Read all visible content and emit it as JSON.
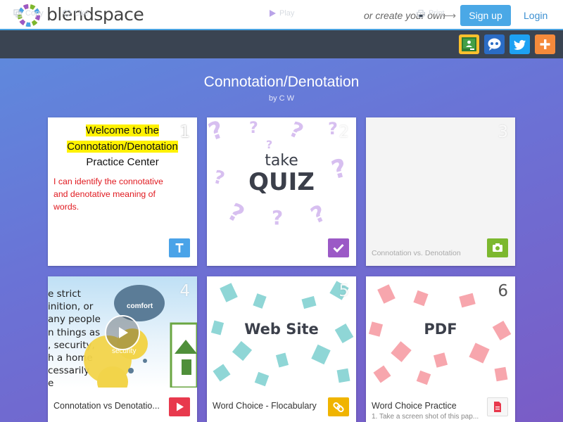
{
  "header": {
    "brand": "blendspace",
    "create_text": "or create your own",
    "signup": "Sign up",
    "login": "Login"
  },
  "toolbar": {
    "copy": "Copy",
    "like": "Like",
    "play": "Play",
    "print": "Print",
    "share": [
      "google-classroom-icon",
      "remind-icon",
      "twitter-icon",
      "plus-icon"
    ]
  },
  "lesson": {
    "title": "Connotation/Denotation",
    "author": "by C W"
  },
  "cards": [
    {
      "number": "1",
      "type": "text",
      "heading": [
        "Welcome to the",
        "Connotation/Denotation",
        "Practice Center"
      ],
      "body": [
        "I can identify the connotative",
        "and denotative meaning of",
        "words."
      ]
    },
    {
      "number": "2",
      "type": "quiz",
      "thumb_line1": "take",
      "thumb_line2": "QUIZ"
    },
    {
      "number": "3",
      "type": "image",
      "caption": "Connotation vs. Denotation"
    },
    {
      "number": "4",
      "type": "video",
      "caption": "Connotation vs  Denotatio...",
      "thumb_text": [
        "e strict",
        "inition, or",
        "any people",
        "n things as",
        ", security,",
        "h a home",
        "cessarily",
        "e"
      ],
      "cloud1": "comfort",
      "cloud2": "security"
    },
    {
      "number": "5",
      "type": "link",
      "thumb_label": "Web Site",
      "caption": "Word Choice - Flocabulary"
    },
    {
      "number": "6",
      "type": "pdf",
      "thumb_label": "PDF",
      "caption": "Word Choice Practice",
      "subcaption": "1. Take a screen shot of this pap..."
    }
  ],
  "colors": {
    "text_badge": "#4aa3e8",
    "quiz_badge": "#9b59c6",
    "image_badge": "#7cb82f",
    "video_badge": "#e8394d",
    "link_badge": "#f0b400",
    "pdf_badge": "#f7f7f7"
  }
}
